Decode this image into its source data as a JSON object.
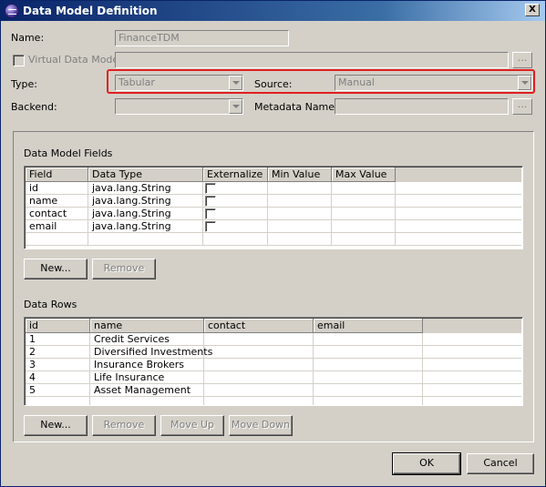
{
  "window": {
    "title": "Data Model Definition",
    "close_label": "X"
  },
  "form": {
    "name_label": "Name:",
    "name_value": "FinanceTDM",
    "virtual_label": "Virtual Data Model",
    "virtual_browse": "...",
    "type_label": "Type:",
    "type_value": "Tabular",
    "source_label": "Source:",
    "source_value": "Manual",
    "backend_label": "Backend:",
    "backend_value": "",
    "metadata_label": "Metadata Name:",
    "metadata_value": "",
    "metadata_browse": "..."
  },
  "fields_section": {
    "title": "Data Model Fields",
    "columns": [
      "Field",
      "Data Type",
      "Externalize",
      "Min Value",
      "Max Value"
    ],
    "rows": [
      {
        "field": "id",
        "type": "java.lang.String",
        "externalize": false,
        "min": "",
        "max": ""
      },
      {
        "field": "name",
        "type": "java.lang.String",
        "externalize": false,
        "min": "",
        "max": ""
      },
      {
        "field": "contact",
        "type": "java.lang.String",
        "externalize": false,
        "min": "",
        "max": ""
      },
      {
        "field": "email",
        "type": "java.lang.String",
        "externalize": false,
        "min": "",
        "max": ""
      }
    ],
    "new_label": "New...",
    "remove_label": "Remove"
  },
  "rows_section": {
    "title": "Data Rows",
    "columns": [
      "id",
      "name",
      "contact",
      "email"
    ],
    "rows": [
      {
        "id": "1",
        "name": "Credit Services",
        "contact": "",
        "email": ""
      },
      {
        "id": "2",
        "name": "Diversified Investments",
        "contact": "",
        "email": ""
      },
      {
        "id": "3",
        "name": "Insurance Brokers",
        "contact": "",
        "email": ""
      },
      {
        "id": "4",
        "name": "Life Insurance",
        "contact": "",
        "email": ""
      },
      {
        "id": "5",
        "name": "Asset Management",
        "contact": "",
        "email": ""
      }
    ],
    "new_label": "New...",
    "remove_label": "Remove",
    "move_up_label": "Move Up",
    "move_down_label": "Move Down"
  },
  "footer": {
    "ok_label": "OK",
    "cancel_label": "Cancel"
  },
  "colors": {
    "highlight": "#e02020",
    "titlebar": "#0a246a",
    "dialog_bg": "#d4d0c8"
  }
}
